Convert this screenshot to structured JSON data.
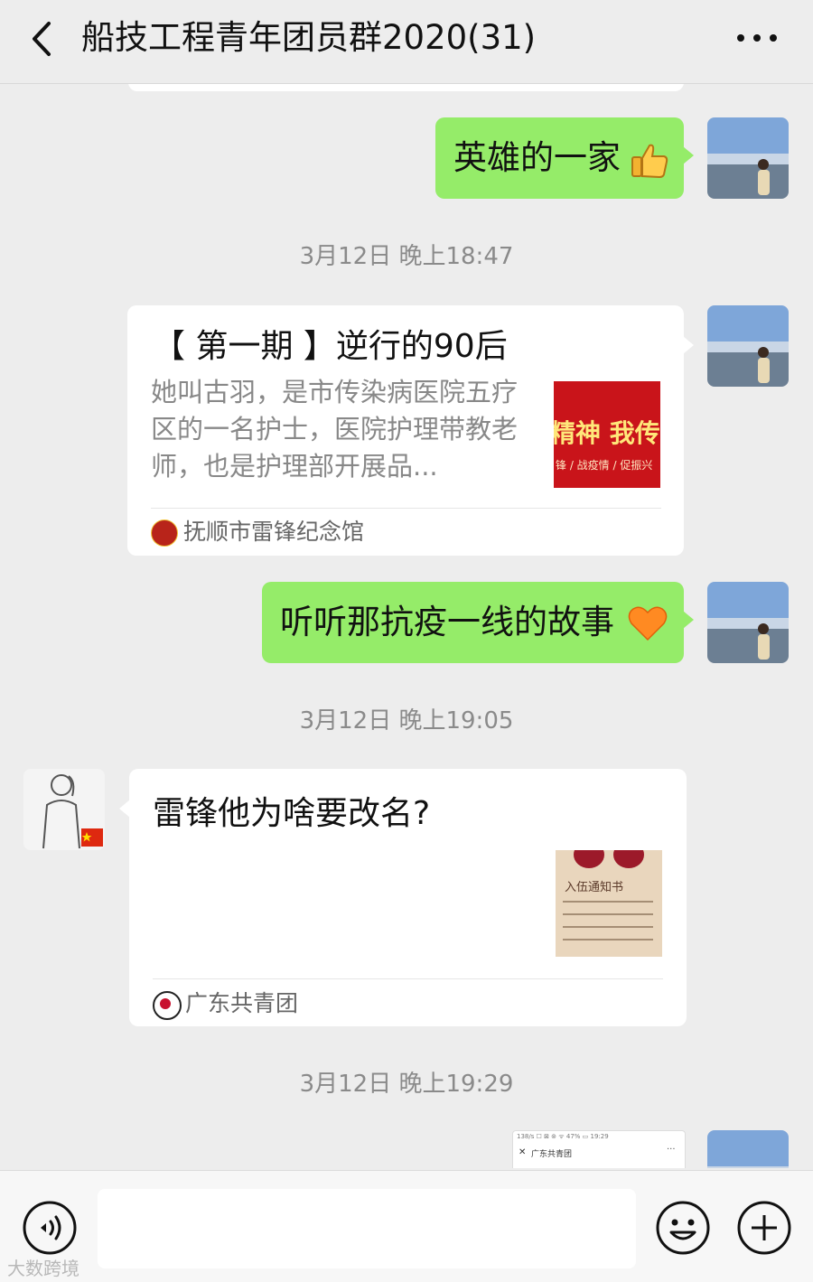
{
  "header": {
    "title": "船技工程青年团员群2020(31)",
    "back_icon": "chevron-left-icon",
    "more_icon": "ellipsis-icon"
  },
  "messages": [
    {
      "type": "text",
      "side": "right",
      "text": "英雄的一家",
      "emoji": "thumbs-up-icon"
    },
    {
      "type": "timestamp",
      "text": "3月12日 晚上18:47"
    },
    {
      "type": "link-card",
      "side": "right",
      "title": "【 第一期 】逆行的90后",
      "description": "她叫古羽，是市传染病医院五疗区的一名护士，医院护理带教老师，也是护理部开展品...",
      "thumbnail_text": "精神 我传",
      "thumbnail_subtext": "锋 / 战疫情 / 促振兴",
      "source": "抚顺市雷锋纪念馆"
    },
    {
      "type": "text",
      "side": "right",
      "text": "听听那抗疫一线的故事",
      "emoji": "orange-heart-icon"
    },
    {
      "type": "timestamp",
      "text": "3月12日 晚上19:05"
    },
    {
      "type": "link-card",
      "side": "left",
      "title": "雷锋他为啥要改名?",
      "thumbnail_text": "入伍通知书",
      "source": "广东共青团"
    },
    {
      "type": "timestamp",
      "text": "3月12日 晚上19:29"
    },
    {
      "type": "image-preview",
      "side": "right",
      "preview_status": "138/s ☐ ⊠ ⊚ ᯤ 47% ▭ 19:29",
      "preview_title": "广东共青团",
      "preview_close": "✕",
      "preview_more": "···"
    }
  ],
  "input_bar": {
    "voice_icon": "voice-icon",
    "emoji_icon": "emoji-face-icon",
    "plus_icon": "plus-circle-icon",
    "input_value": ""
  },
  "watermark": "大数跨境",
  "colors": {
    "background": "#ededed",
    "sent_bubble": "#95ec69",
    "received_bubble": "#ffffff",
    "timestamp": "#8a8a8a"
  }
}
